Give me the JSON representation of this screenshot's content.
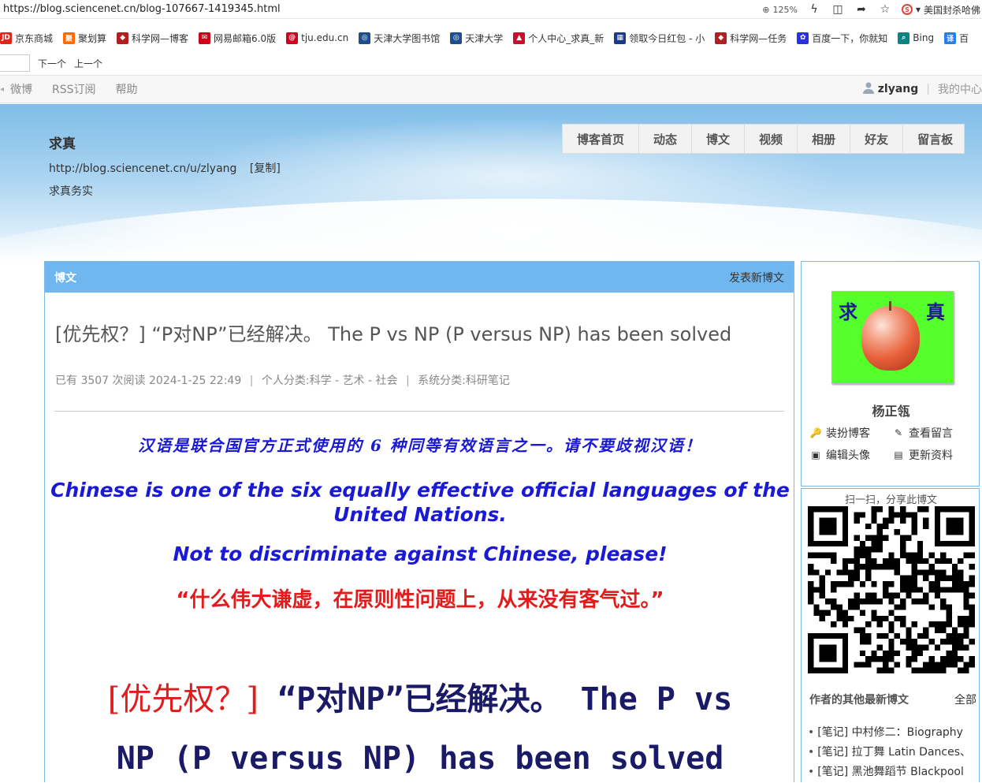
{
  "browser": {
    "url": "https://blog.sciencenet.cn/blog-107667-1419345.html",
    "zoom": "125%",
    "news_snippet": "美国封杀哈佛",
    "bookmarks": [
      {
        "label": "京东商城",
        "fav": "JD",
        "color": "#e1251b"
      },
      {
        "label": "聚划算",
        "fav": "聚",
        "color": "#ff6a00"
      },
      {
        "label": "科学网—博客",
        "fav": "◆",
        "color": "#b02020"
      },
      {
        "label": "网易邮箱6.0版",
        "fav": "✉",
        "color": "#d0021b"
      },
      {
        "label": "tju.edu.cn",
        "fav": "@",
        "color": "#d0021b"
      },
      {
        "label": "天津大学图书馆",
        "fav": "◎",
        "color": "#1f4e8c"
      },
      {
        "label": "天津大学",
        "fav": "◎",
        "color": "#1f4e8c"
      },
      {
        "label": "个人中心_求真_新",
        "fav": "▲",
        "color": "#c8102e"
      },
      {
        "label": "领取今日红包 - 小",
        "fav": "▦",
        "color": "#1a3a8a"
      },
      {
        "label": "科学网—任务",
        "fav": "◆",
        "color": "#b02020"
      },
      {
        "label": "百度一下，你就知",
        "fav": "✿",
        "color": "#2932e1"
      },
      {
        "label": "Bing",
        "fav": "⌕",
        "color": "#0c8484"
      },
      {
        "label": "百",
        "fav": "译",
        "color": "#2b7de9"
      }
    ],
    "find": {
      "next": "下一个",
      "prev": "上一个"
    }
  },
  "topnav": {
    "items": [
      "微博",
      "RSS订阅",
      "帮助"
    ],
    "username": "zlyang",
    "my_center": "我的中心"
  },
  "banner": {
    "title": "求真",
    "url": "http://blog.sciencenet.cn/u/zlyang",
    "copy": "[复制]",
    "motto": "求真务实",
    "tabs": [
      "博客首页",
      "动态",
      "博文",
      "视频",
      "相册",
      "好友",
      "留言板"
    ]
  },
  "article": {
    "section_label": "博文",
    "new_post": "发表新博文",
    "title": "[优先权？] “P对NP”已经解决。 The P vs NP (P versus NP) has been solved",
    "reads_prefix": "已有",
    "reads": "3507",
    "reads_suffix": "次阅读",
    "datetime": "2024-1-25 22:49",
    "personal_category": "个人分类:科学 - 艺术 - 社会",
    "system_category": "系统分类:科研笔记",
    "line1": "汉语是联合国官方正式使用的 6 种同等有效语言之一。请不要歧视汉语！",
    "line2": "Chinese is one of the six equally effective official languages of the United Nations.",
    "line3": "Not to discriminate against Chinese, please!",
    "line4": "“什么伟大谦虚，在原则性问题上，从来没有客气过。”",
    "heading_red": "[优先权？]",
    "heading_rest_1": " “P对NP”已经解决。 The P vs",
    "heading_rest_2": "NP (P versus NP) has been solved"
  },
  "profile": {
    "avatar_left": "求",
    "avatar_right": "真",
    "name": "杨正瓴",
    "links": [
      "装扮博客",
      "查看留言",
      "编辑头像",
      "更新资料"
    ]
  },
  "share": {
    "caption": "扫一扫，分享此博文",
    "others_title": "作者的其他最新博文",
    "all": "全部",
    "items": [
      "[笔记] 中村修二：Biography",
      "[笔记] 拉丁舞 Latin Dances、",
      "[笔记] 黑池舞蹈节 Blackpool"
    ]
  }
}
